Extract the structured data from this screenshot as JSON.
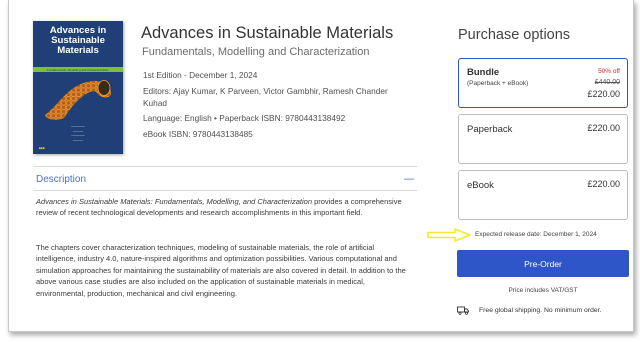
{
  "book": {
    "cover_title": "Advances in Sustainable Materials",
    "cover_subtitle": "Fundamentals, Modelling and Characterization",
    "title": "Advances in Sustainable Materials",
    "subtitle": "Fundamentals, Modelling and Characterization",
    "edition": "1st Edition - December 1, 2024",
    "editors": "Editors: Ajay Kumar, K Parveen, Victor Gambhir, Ramesh Chander Kuhad",
    "language_isbn": "Language: English  •  Paperback ISBN: 9780443138492",
    "ebook_isbn": "eBook ISBN: 9780443138485",
    "colors": {
      "cover_bg": "#1f3f76",
      "cover_band": "#7bbf3a",
      "cover_art": "#d07a1c"
    }
  },
  "description": {
    "header": "Description",
    "collapse_icon": "minus",
    "p1_italic": "Advances in Sustainable Materials: Fundamentals, Modelling, and Characterization",
    "p1_rest": " provides a comprehensive review of recent technological developments and research accomplishments in this important field.",
    "p2": "The chapters cover characterization techniques, modeling of sustainable materials, the role of artificial intelligence, industry 4.0, nature-inspired algorithms and optimization possibilities. Various computational and simulation approaches for maintaining the sustainability of materials are also covered in detail. In addition to the above various case studies are also included on the application of sustainable materials in medical, environmental, production, mechanical and civil engineering."
  },
  "purchase": {
    "title": "Purchase options",
    "options": [
      {
        "name": "Bundle",
        "sub": "(Paperback + eBook)",
        "discount": "50% off",
        "old_price": "£440.00",
        "price": "£220.00",
        "selected": true
      },
      {
        "name": "Paperback",
        "price": "£220.00",
        "selected": false
      },
      {
        "name": "eBook",
        "price": "£220.00",
        "selected": false
      }
    ],
    "release_date": "Expected release date: December 1, 2024",
    "preorder_label": "Pre-Order",
    "vat_note": "Price includes VAT/GST",
    "shipping_note": "Free global shipping. No minimum order.",
    "shipping_icon": "truck",
    "accent_color": "#2f56c9",
    "annotation_arrow_color": "#f4ea2a"
  }
}
